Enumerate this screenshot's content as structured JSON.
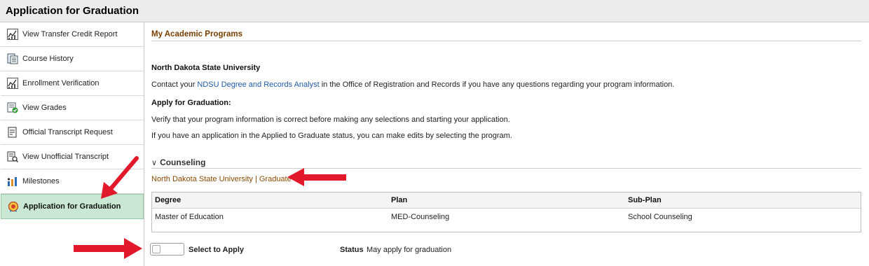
{
  "window": {
    "title": "Application for Graduation"
  },
  "sidebar": {
    "items": [
      {
        "label": "View Transfer Credit Report",
        "icon": "chart-icon"
      },
      {
        "label": "Course History",
        "icon": "document-list-icon"
      },
      {
        "label": "Enrollment Verification",
        "icon": "chart-icon"
      },
      {
        "label": "View Grades",
        "icon": "grade-report-icon"
      },
      {
        "label": "Official Transcript Request",
        "icon": "transcript-request-icon"
      },
      {
        "label": "View Unofficial Transcript",
        "icon": "transcript-view-icon"
      },
      {
        "label": "Milestones",
        "icon": "milestones-icon"
      },
      {
        "label": "Application for Graduation",
        "icon": "graduation-icon",
        "active": true
      }
    ]
  },
  "main": {
    "section_title": "My Academic Programs",
    "institution": "North Dakota State University",
    "contact": {
      "before": "Contact your ",
      "link": "NDSU Degree and Records Analyst",
      "after": " in the Office of Registration and Records if you have any questions regarding your program information."
    },
    "apply_heading": "Apply for Graduation:",
    "instruction_1": "Verify that your program information is correct before making any selections and starting your application.",
    "instruction_2": "If you have an application in the Applied to Graduate status, you can make edits by selecting the program.",
    "group": {
      "title": "Counseling",
      "program_link": "North Dakota State University | Graduate",
      "columns": [
        "Degree",
        "Plan",
        "Sub-Plan"
      ],
      "row": [
        "Master of Education",
        "MED-Counseling",
        "School Counseling"
      ]
    },
    "select_label": "Select to Apply",
    "status_label": "Status",
    "status_value": "May apply for graduation"
  },
  "colors": {
    "accent": "#7a3e00",
    "link": "#1f5aa6",
    "active_bg": "#c9e7d3",
    "annotation_arrow": "#e2192a"
  }
}
